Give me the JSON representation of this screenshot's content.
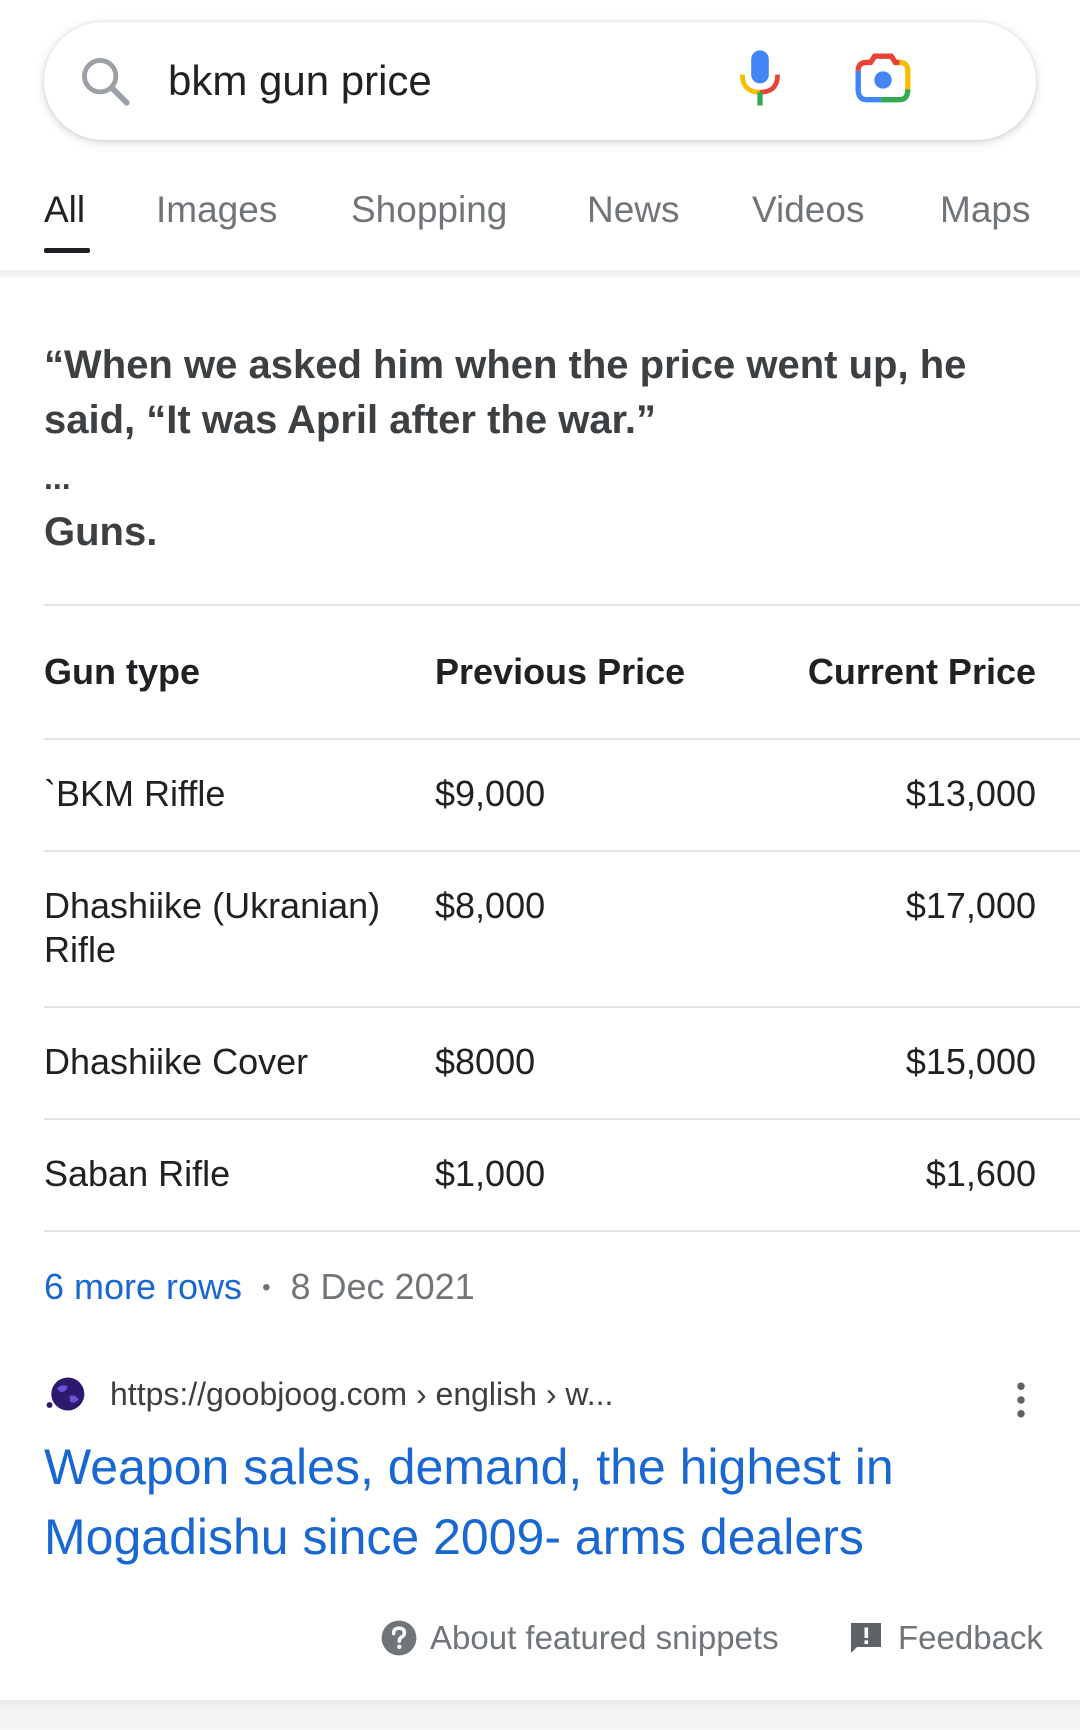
{
  "search": {
    "query": "bkm gun price"
  },
  "tabs": [
    {
      "label": "All",
      "active": true
    },
    {
      "label": "Images",
      "active": false
    },
    {
      "label": "Shopping",
      "active": false
    },
    {
      "label": "News",
      "active": false
    },
    {
      "label": "Videos",
      "active": false
    },
    {
      "label": "Maps",
      "active": false
    }
  ],
  "snippet": {
    "quote": "“When we asked him when the price went up, he said, “It was April after the war.”",
    "ellipsis": "...",
    "tail": "Guns."
  },
  "table": {
    "headers": [
      "Gun type",
      "Previous Price",
      "Current Price"
    ],
    "rows": [
      [
        "`BKM Riffle",
        "$9,000",
        "$13,000"
      ],
      [
        "Dhashiike (Ukranian) Rifle",
        "$8,000",
        "$17,000"
      ],
      [
        "Dhashiike Cover",
        "$8000",
        "$15,000"
      ],
      [
        "Saban Rifle",
        "$1,000",
        "$1,600"
      ]
    ],
    "more_rows_label": "6 more rows",
    "separator": "•",
    "date": "8 Dec 2021"
  },
  "result": {
    "url": "https://goobjoog.com › english › w...",
    "title": "Weapon sales, demand, the highest in Mogadishu since 2009- arms dealers"
  },
  "footer": {
    "about_label": "About featured snippets",
    "feedback_label": "Feedback"
  },
  "icons": {
    "search": "search-icon",
    "mic": "mic-icon",
    "lens": "lens-icon",
    "favicon": "globe-favicon-icon",
    "menu": "kebab-menu-icon",
    "help": "help-icon",
    "feedback": "feedback-icon"
  },
  "colors": {
    "link_blue": "#1967d2",
    "text_primary": "#202124",
    "text_secondary": "#70757a",
    "google_blue": "#4285f4",
    "google_red": "#ea4335",
    "google_yellow": "#fbbc04",
    "google_green": "#34a853"
  }
}
